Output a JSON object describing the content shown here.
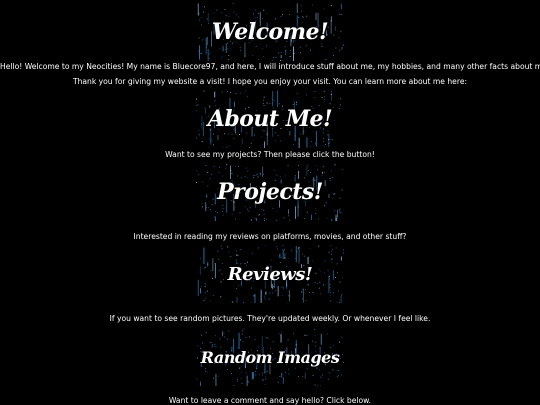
{
  "welcome": {
    "title": "Welcome!",
    "intro": "Hello! Welcome to my Neocities! My name is Bluecore97, and here, I will introduce stuff about me, my hobbies, and many other facts about myself.",
    "thanks": "Thank you for giving my website a visit! I hope you enjoy your visit. You can learn more about me here:"
  },
  "about": {
    "title": "About Me!",
    "caption": "Want to see my projects? Then please click the button!"
  },
  "projects": {
    "title": "Projects!",
    "caption": "Interested in reading my reviews on platforms, movies, and other stuff?"
  },
  "reviews": {
    "title": "Reviews!",
    "caption": "If you want to see random pictures. They're updated weekly. Or whenever I feel like."
  },
  "random_images": {
    "title": "Random Images",
    "caption": "Want to leave a comment and say hello? Click below."
  },
  "colors": {
    "background": "#000000",
    "text": "#ffffff",
    "star_blue": "#2f8fd6",
    "star_light": "#9fd4ff"
  }
}
